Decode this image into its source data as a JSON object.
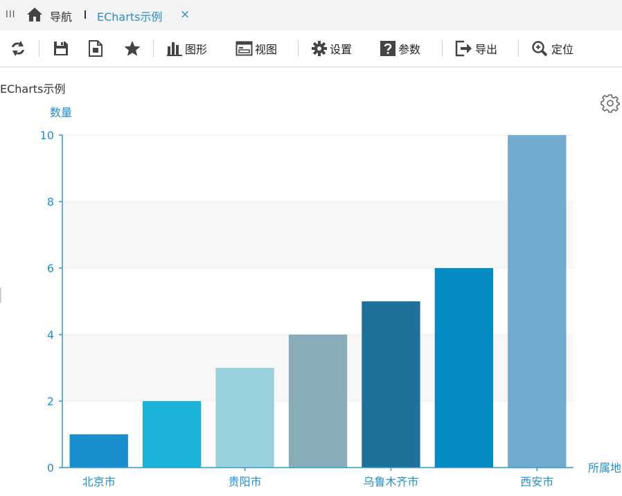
{
  "tabs": {
    "nav_label": "导航",
    "active_label": "ECharts示例",
    "close_glyph": "×"
  },
  "toolbar": {
    "chart_label": "图形",
    "view_label": "视图",
    "settings_label": "设置",
    "params_label": "参数",
    "export_label": "导出",
    "locate_label": "定位"
  },
  "page": {
    "title": "ECharts示例"
  },
  "colors": {
    "axis": "#2a9bd0",
    "label": "#1f8fcf",
    "grid_band": "#f7f7f7",
    "grid_line": "#ececec"
  },
  "chart_data": {
    "type": "bar",
    "ylabel": "数量",
    "xlabel": "所属地",
    "ylim": [
      0,
      10
    ],
    "yticks": [
      0,
      2,
      4,
      6,
      8,
      10
    ],
    "categories": [
      "北京市",
      "",
      "贵阳市",
      "",
      "乌鲁木齐市",
      "",
      "西安市"
    ],
    "values": [
      1,
      2,
      3,
      4,
      5,
      6,
      10
    ],
    "colors": [
      "#1a8fcf",
      "#1bb2d8",
      "#99d2dd",
      "#88adb8",
      "#1f719b",
      "#058bc4",
      "#72aad0"
    ],
    "grid": true,
    "legend": "none"
  }
}
